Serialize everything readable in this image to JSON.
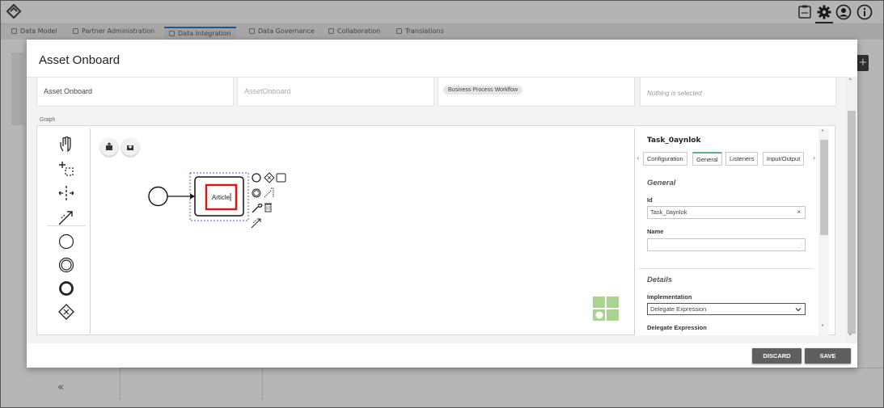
{
  "app": {
    "tabs": [
      {
        "label": "Data Model"
      },
      {
        "label": "Partner Administration"
      },
      {
        "label": "Data Integration"
      },
      {
        "label": "Data Governance"
      },
      {
        "label": "Collaboration"
      },
      {
        "label": "Translations"
      }
    ],
    "active_tab": "Data Integration",
    "header_icons": [
      "clipboard-icon",
      "gear-icon",
      "user-icon",
      "info-icon"
    ],
    "accent_color": "#1d75c4"
  },
  "modal": {
    "title": "Asset Onboard",
    "fields": {
      "name": "Asset Onboard",
      "id_placeholder": "AssetOnboard",
      "type": "Business Process Workflow",
      "selection": "Nothing is selected"
    },
    "graph_label": "Graph",
    "diagram": {
      "task_label": "Article",
      "highlight_color": "#d11a1a"
    },
    "properties": {
      "title": "Task_0aynlok",
      "tabs": [
        "Configuration",
        "General",
        "Listeners",
        "Input/Output"
      ],
      "active_tab": "General",
      "general_heading": "General",
      "id_label": "Id",
      "id_value": "Task_0aynlok",
      "clear_symbol": "×",
      "name_label": "Name",
      "name_value": "",
      "details_heading": "Details",
      "implementation_label": "Implementation",
      "implementation_value": "Delegate Expression",
      "delegate_label": "Delegate Expression"
    },
    "buttons": {
      "discard": "DISCARD",
      "save": "SAVE"
    }
  }
}
